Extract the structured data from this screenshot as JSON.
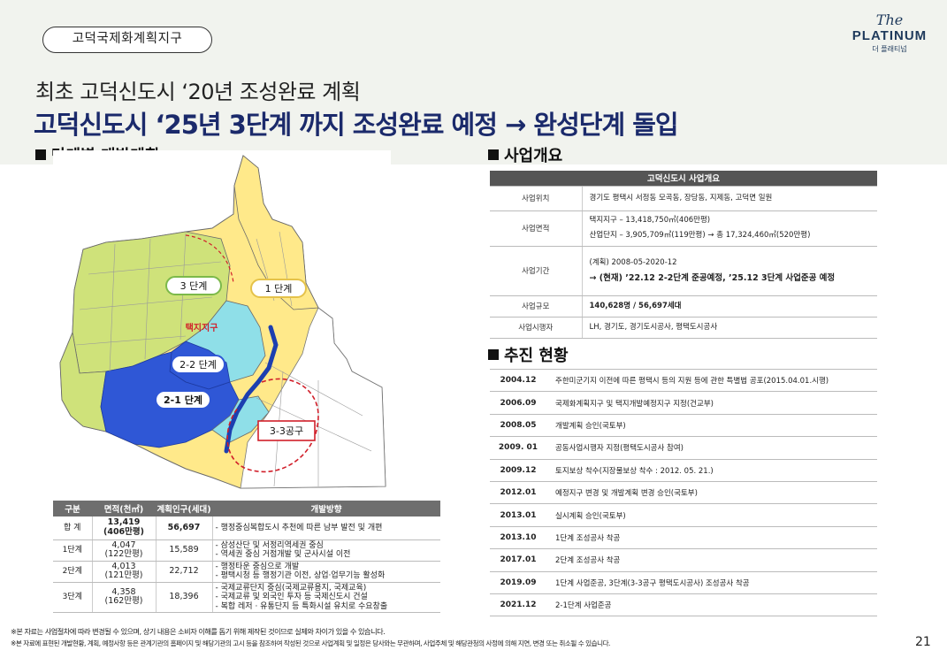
{
  "tag": "고덕국제화계획지구",
  "logo": {
    "script": "The",
    "name": "PLATINUM",
    "sub": "더 플래티넘"
  },
  "subtitle": "최초 고덕신도시 ‘20년 조성완료 계획",
  "title": "고덕신도시 ‘25년 3단계 까지 조성완료 예정 → 완성단계 돌입",
  "left": {
    "heading": "단계별 개발계획",
    "map_labels": {
      "phase3": "3 단계",
      "phase1": "1 단계",
      "taekji": "택지지구",
      "phase22": "2-2 단계",
      "phase21": "2-1 단계",
      "zone33": "3-3공구"
    },
    "table": {
      "headers": [
        "구분",
        "면적(천㎡)",
        "계획인구(세대)",
        "개발방향"
      ],
      "rows": [
        {
          "cat": "합 계",
          "area1": "13,419",
          "area2": "(406만평)",
          "pop": "56,697",
          "dir": [
            "- 행정중심복합도시 추천에 따른 남부 발전 및 개편"
          ]
        },
        {
          "cat": "1단계",
          "area1": "4,047",
          "area2": "(122만평)",
          "pop": "15,589",
          "dir": [
            "- 삼성산단 및 서정리역세권 중심",
            "- 역세권 중심 거점개발 및 군사시설 이전"
          ]
        },
        {
          "cat": "2단계",
          "area1": "4,013",
          "area2": "(121만평)",
          "pop": "22,712",
          "dir": [
            "- 행정타운 중심으로 개발",
            "- 평택시청 등 행정기관 이전, 상업·업무기능 활성화"
          ]
        },
        {
          "cat": "3단계",
          "area1": "4,358",
          "area2": "(162만평)",
          "pop": "18,396",
          "dir": [
            "- 국제교류단지 중심(국제교류용지, 국제교육)",
            "- 국제교류 및 외국인 투자 등 국제신도시 건설",
            "- 복합 레저 · 유통단지 등 특화시설 유치로 수요창출"
          ]
        }
      ]
    }
  },
  "right": {
    "overview_heading": "사업개요",
    "overview_caption": "고덕신도시 사업개요",
    "overview_rows": [
      {
        "key": "사업위치",
        "lines": [
          "경기도 평택시 서정동 모곡동, 장당동, 지제동, 고덕면 일원"
        ]
      },
      {
        "key": "사업면적",
        "lines": [
          "택지지구 – 13,418,750㎡(406만평)",
          "산업단지 – 3,905,709㎡(119만평) → 총 17,324,460㎡(520만평)"
        ]
      },
      {
        "key": "사업기간",
        "lines": [
          "(계획) 2008-05-2020-12",
          "→ (현재) ’22.12 2-2단계 준공예정, ’25.12 3단계 사업준공 예정"
        ]
      },
      {
        "key": "사업규모",
        "lines": [
          "140,628명 / 56,697세대"
        ]
      },
      {
        "key": "사업시행자",
        "lines": [
          "LH, 경기도, 경기도시공사, 평택도시공사"
        ]
      }
    ],
    "progress_heading": "추진 현황",
    "progress_rows": [
      {
        "date": "2004.12",
        "event": "주한미군기지 이전에 따른 평택시 등의 지원 등에 관한 특별법 공포(2015.04.01.시행)"
      },
      {
        "date": "2006.09",
        "event": "국제화계획지구 및 택지개발예정지구 지정(건교부)"
      },
      {
        "date": "2008.05",
        "event": "개발계획 승인(국토부)"
      },
      {
        "date": "2009. 01",
        "event": "공동사업시행자 지정(평택도시공사 참여)"
      },
      {
        "date": "2009.12",
        "event": "토지보상 착수(지장물보상 착수 : 2012. 05. 21.)"
      },
      {
        "date": "2012.01",
        "event": "예정지구 변경 및 개발계획 변경 승인(국토부)"
      },
      {
        "date": "2013.01",
        "event": "실시계획 승인(국토부)"
      },
      {
        "date": "2013.10",
        "event": "1단계 조성공사 착공"
      },
      {
        "date": "2017.01",
        "event": "2단계 조성공사 착공"
      },
      {
        "date": "2019.09",
        "event": "1단계 사업준공, 3단계(3-3공구 평택도시공사) 조성공사 착공"
      },
      {
        "date": "2021.12",
        "event": "2-1단계 사업준공"
      }
    ]
  },
  "notes": [
    "※본 자료는 사업절차에 따라 변경될 수 있으며, 상기 내용은 소비자 이해를 돕기 위해 제작된 것이므로 실제와 차이가 있을 수 있습니다.",
    "※본 자료에 표현된 개발현황, 계획, 예정사항 등은 관계기관의 홈페이지 및 해당기관의 고시 등을 참조하여 작성된 것으로 사업계획 및 일정은 당사와는 무관하며, 사업주체 및 해당관청의 사정에 의해 지연, 변경 또는 취소될 수 있습니다."
  ],
  "page": "21",
  "colors": {
    "title_navy": "#1b2a6b",
    "phase_blue": "#2f57d6",
    "phase_cyan": "#8fdfe8",
    "phase_yellow": "#ffe98a",
    "phase_green": "#cfe27a",
    "accent_red": "#d11f2a"
  }
}
